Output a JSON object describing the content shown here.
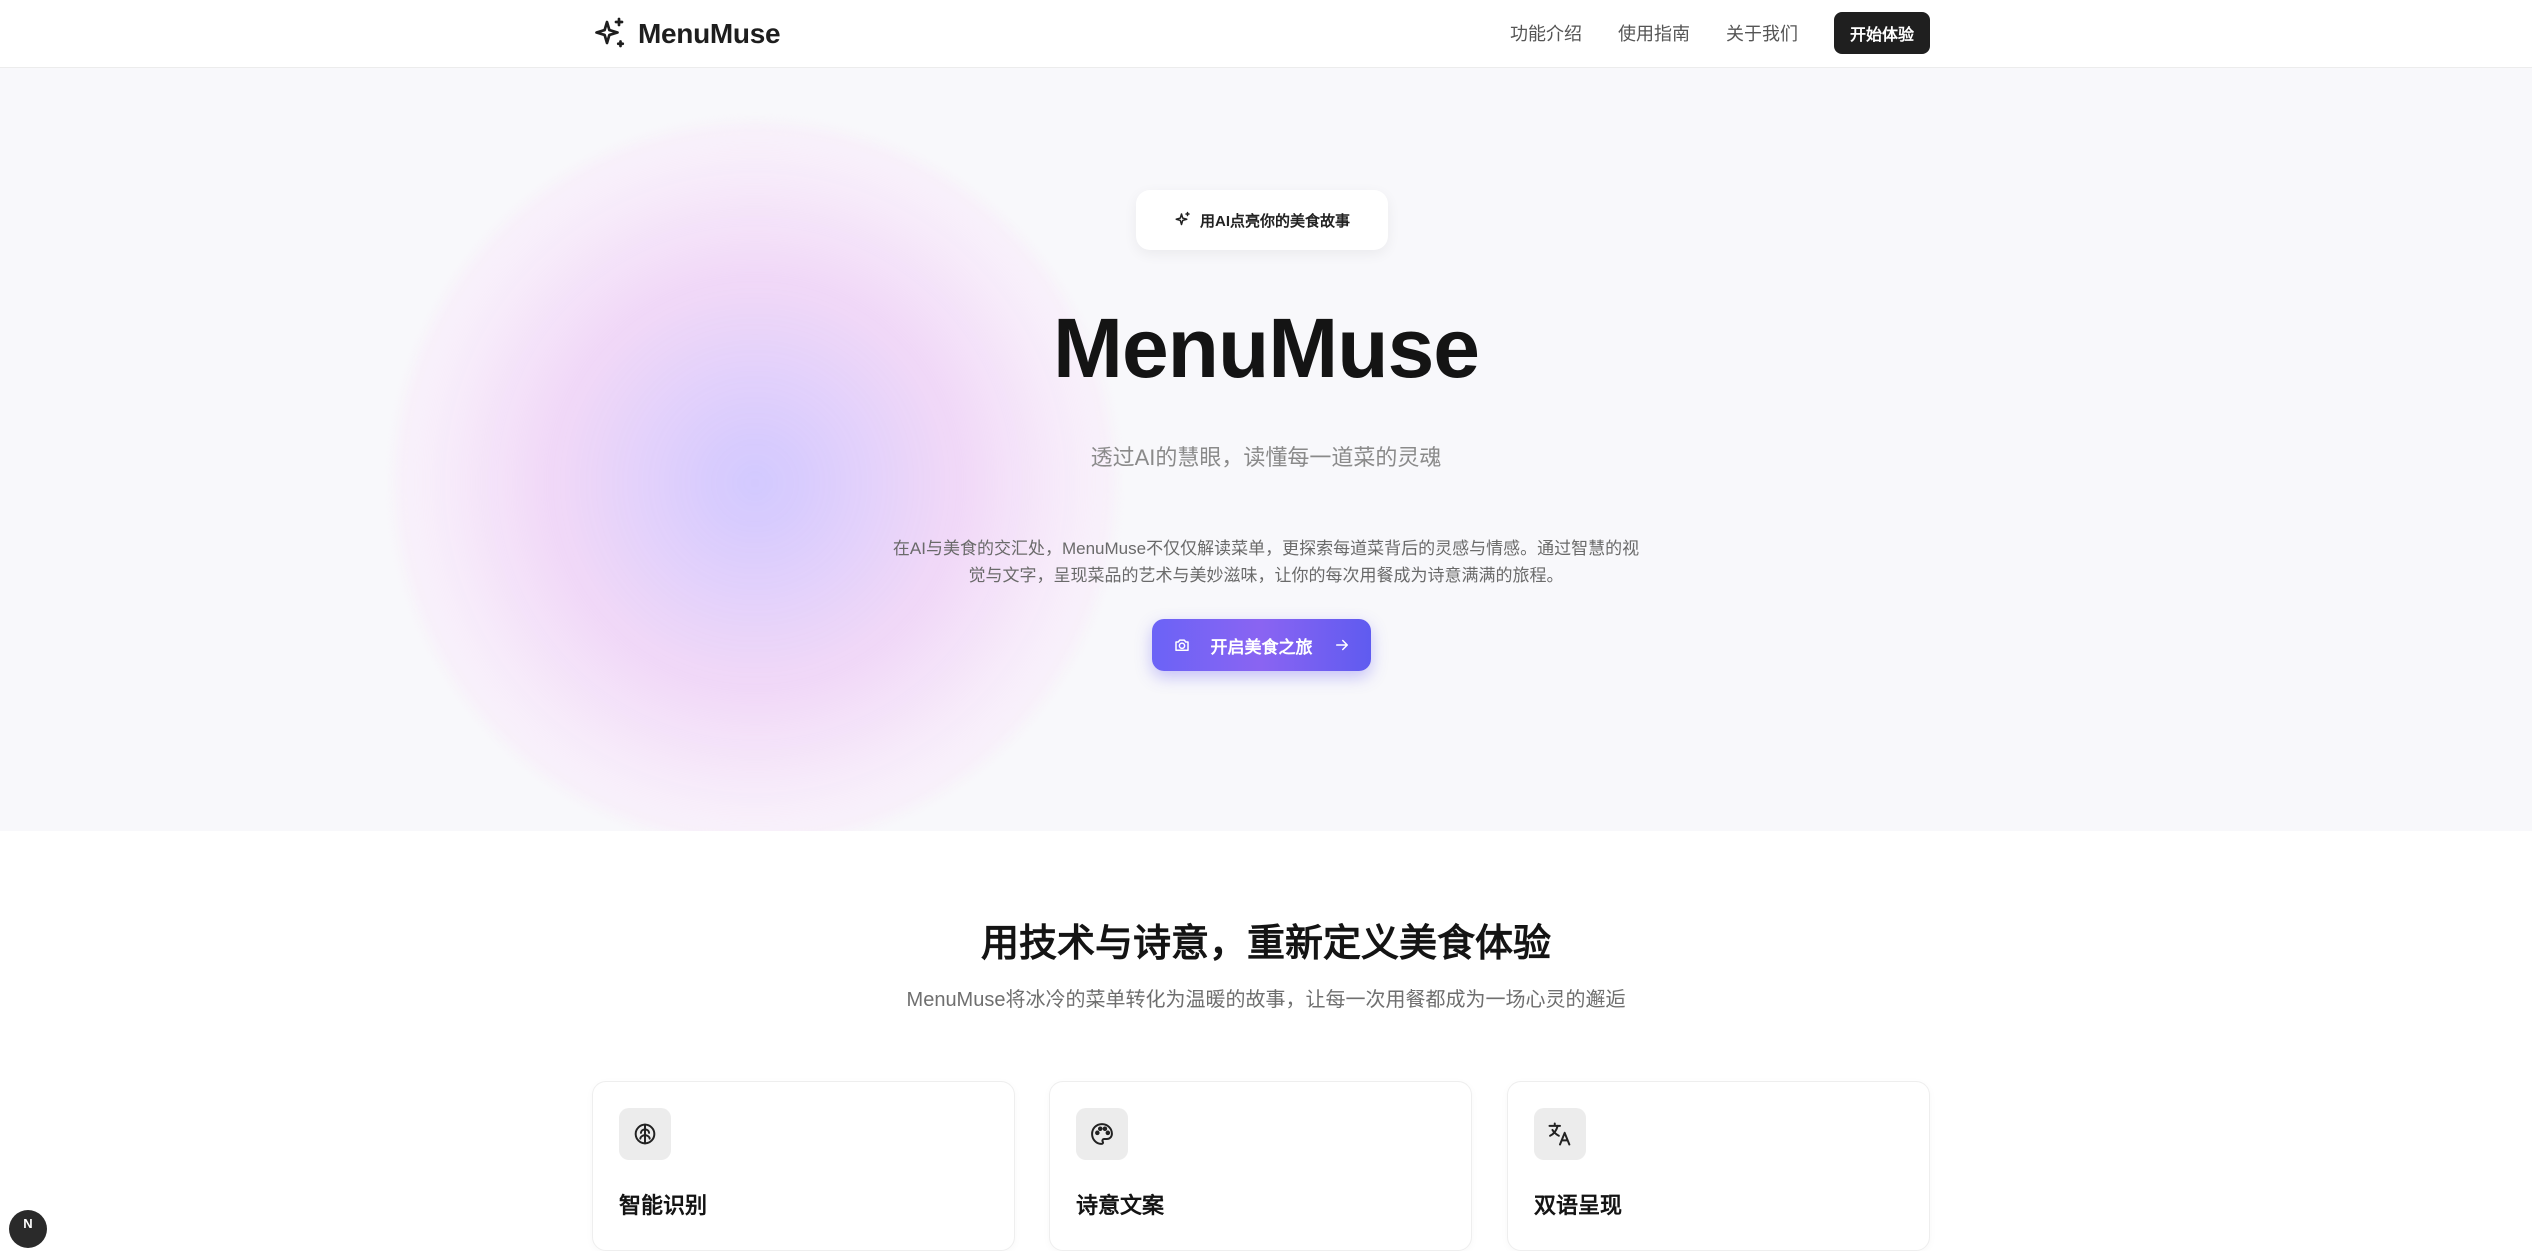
{
  "header": {
    "brand": "MenuMuse",
    "nav": [
      {
        "label": "功能介绍"
      },
      {
        "label": "使用指南"
      },
      {
        "label": "关于我们"
      }
    ],
    "cta_label": "开始体验"
  },
  "hero": {
    "badge_text": "用AI点亮你的美食故事",
    "title": "MenuMuse",
    "subtitle": "透过AI的慧眼，读懂每一道菜的灵魂",
    "description": "在AI与美食的交汇处，MenuMuse不仅仅解读菜单，更探索每道菜背后的灵感与情感。通过智慧的视觉与文字，呈现菜品的艺术与美妙滋味，让你的每次用餐成为诗意满满的旅程。",
    "button_label": "开启美食之旅"
  },
  "features": {
    "title": "用技术与诗意，重新定义美食体验",
    "subtitle": "MenuMuse将冰冷的菜单转化为温暖的故事，让每一次用餐都成为一场心灵的邂逅",
    "cards": [
      {
        "title": "智能识别",
        "icon": "brain-icon"
      },
      {
        "title": "诗意文案",
        "icon": "palette-icon"
      },
      {
        "title": "双语呈现",
        "icon": "translate-icon"
      }
    ]
  },
  "corner_badge": {
    "label": "N"
  },
  "colors": {
    "primary_dark": "#1f1f1f",
    "accent_gradient_start": "#6b63f6",
    "accent_gradient_end": "#8a64f2",
    "hero_background": "#f8f8fb"
  }
}
